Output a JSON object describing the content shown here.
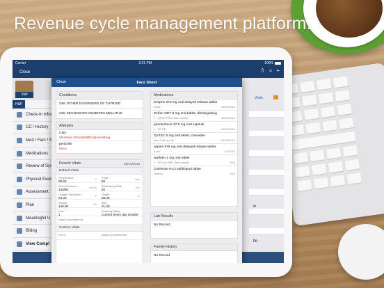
{
  "headline": "Revenue cycle management platform.",
  "statusbar": {
    "carrier": "Carrier",
    "time": "2:21 PM",
    "battery": "100%"
  },
  "navbar": {
    "close_label": "Close",
    "visit_label": "Visit",
    "right_date": "10/13/2016"
  },
  "sidebar": {
    "tab_hp": "H&P",
    "items": [
      {
        "label": "Check-In Infor",
        "icon": "checkin-icon"
      },
      {
        "label": "CC / History",
        "icon": "history-icon"
      },
      {
        "label": "Med / Fam / S",
        "icon": "family-icon"
      },
      {
        "label": "Medications",
        "icon": "medication-icon"
      },
      {
        "label": "Review of Sys",
        "icon": "review-icon"
      },
      {
        "label": "Physical Exam",
        "icon": "exam-icon"
      },
      {
        "label": "Assessment",
        "icon": "assessment-icon"
      },
      {
        "label": "Plan",
        "icon": "plan-icon"
      },
      {
        "label": "Meaningful U",
        "icon": "meaningful-use-icon"
      },
      {
        "label": "Billing",
        "icon": "billing-icon"
      },
      {
        "label": "View Compl",
        "icon": "view-complete-icon"
      }
    ]
  },
  "background_main": {
    "vitals_link": "Vitals",
    "text_right_1": "w",
    "text_right_2": "tle"
  },
  "modal": {
    "close_label": "Close",
    "title": "Face Sheet",
    "conditions": {
      "header": "Conditions",
      "items": [
        "246: OTHER DISORDERS OF THYROID",
        "249: SECONDARY DIABETES MELLITUS"
      ]
    },
    "allergies": {
      "header": "Allergies",
      "items": [
        {
          "name": "Cats",
          "reaction": "Shortness of breath/difficulty breathing"
        },
        {
          "name": "penicillin",
          "reaction": "Hives"
        }
      ]
    },
    "recent_vitals": {
      "header": "Recent Vitals",
      "date": "10/13/2016",
      "default_label": "Default Vitals",
      "cells": [
        {
          "label": "Temperature",
          "value": "98.60",
          "unit": "F"
        },
        {
          "label": "Pulse",
          "value": "56",
          "unit": "bpm"
        },
        {
          "label": "Blood Pressure",
          "value": "130/80",
          "unit": "mmHg"
        },
        {
          "label": "Respiratory Rate",
          "value": "40",
          "unit": "rpm"
        },
        {
          "label": "Oxygen Saturation",
          "value": "94.00",
          "unit": "%"
        },
        {
          "label": "Height",
          "value": "68.00",
          "unit": "in"
        },
        {
          "label": "Weight",
          "value": "140.00",
          "unit": "lbs"
        },
        {
          "label": "BMI",
          "value": "21.29",
          "unit": ""
        },
        {
          "label": "Pain",
          "value": "1",
          "unit": ""
        },
        {
          "label": "Smoking Status",
          "value": "Current every day smoker",
          "unit": ""
        },
        {
          "label": "Head Circumference",
          "value": "",
          "unit": ""
        }
      ],
      "custom_label": "Custom Vitals",
      "custom_cells": [
        {
          "label": "Fat %",
          "value": ""
        },
        {
          "label": "Waist Circumference",
          "value": ""
        }
      ]
    },
    "medications": {
      "header": "Medications",
      "items": [
        {
          "name": "Eesprin 976 mg oral delayed release tablet",
          "sig": "Asws",
          "date": "06/20/2014"
        },
        {
          "name": "Zofran ODT 8 mg oral tablet, disintegrating",
          "sig": "1 · QPNd PRN Take weekly",
          "date": "06/20/2014"
        },
        {
          "name": "phentermine 37.5 mg oral capsule",
          "sig": "1 · 50 TID",
          "date": "06/09/2014"
        },
        {
          "name": "ZyrTEC 5 mg oral tablet, chewable",
          "sig": "take 1 tab po qd",
          "date": "03/26/2013"
        },
        {
          "name": "aspirin 976 mg oral delayed release tablet",
          "sig": "3 pm",
          "date": "1/7/2012"
        },
        {
          "name": "warfarin 1 mg oral tablet",
          "sig": "1 · 50 QID PRN Take weekly",
          "date": "N/A"
        },
        {
          "name": "Celebrate 8-12 sublingual tablet",
          "sig": "Testing",
          "date": "N/A"
        }
      ]
    },
    "lab_results": {
      "header": "Lab Results",
      "empty": "No Record"
    },
    "family_history": {
      "header": "Family History",
      "empty": "No Record"
    }
  }
}
